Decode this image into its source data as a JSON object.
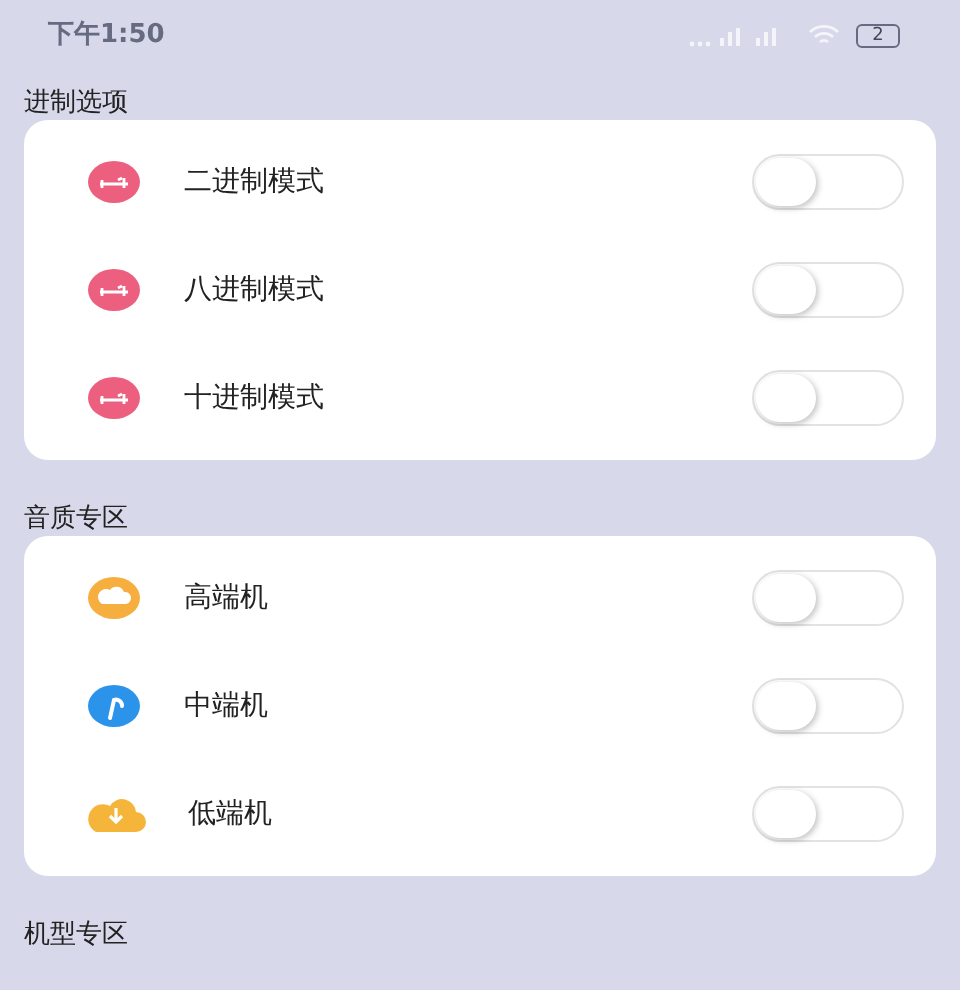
{
  "status_bar": {
    "time": "下午1:50",
    "battery": "2"
  },
  "sections": [
    {
      "title": "进制选项",
      "items": [
        {
          "label": "二进制模式",
          "on": false
        },
        {
          "label": "八进制模式",
          "on": false
        },
        {
          "label": "十进制模式",
          "on": false
        }
      ]
    },
    {
      "title": "音质专区",
      "items": [
        {
          "label": "高端机",
          "on": false
        },
        {
          "label": "中端机",
          "on": false
        },
        {
          "label": "低端机",
          "on": false
        }
      ]
    },
    {
      "title": "机型专区"
    }
  ]
}
